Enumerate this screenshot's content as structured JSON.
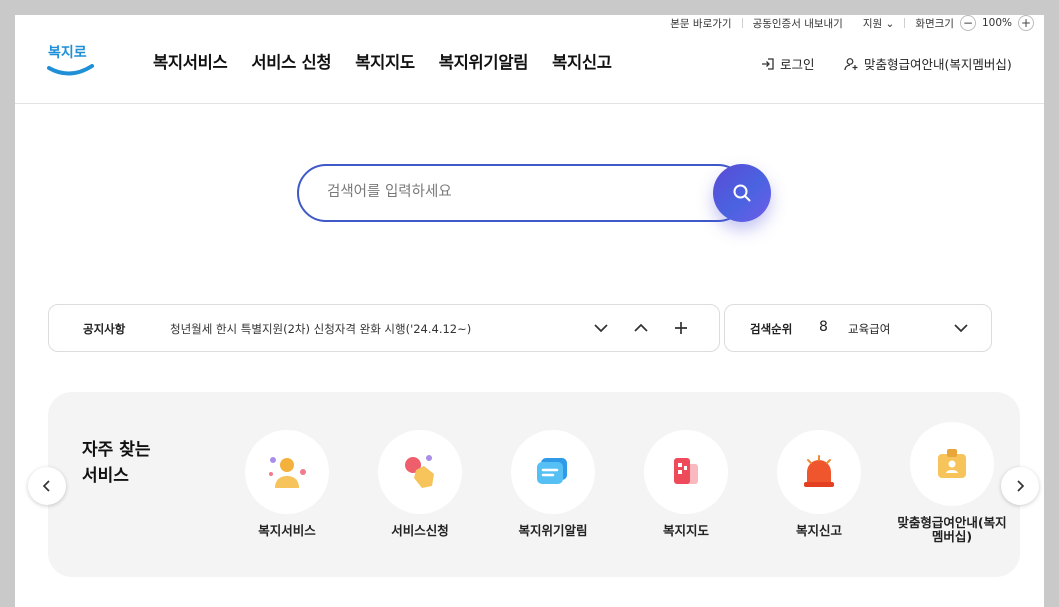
{
  "utility": {
    "skip_link": "본문 바로가기",
    "cert_export": "공동인증서 내보내기",
    "support": "지원",
    "screen_size": "화면크기",
    "zoom_minus": "−",
    "zoom_value": "100%",
    "zoom_plus": "+"
  },
  "logo": {
    "text": "복지로"
  },
  "nav": {
    "items": [
      "복지서비스",
      "서비스 신청",
      "복지지도",
      "복지위기알림",
      "복지신고"
    ]
  },
  "account": {
    "login": "로그인",
    "membership": "맞춤형급여안내(복지멤버십)"
  },
  "search": {
    "placeholder": "검색어를 입력하세요"
  },
  "notice": {
    "label": "공지사항",
    "text": "청년월세 한시 특별지원(2차) 신청자격 완화 시행('24.4.12~)"
  },
  "rank": {
    "label": "검색순위",
    "number": "8",
    "keyword": "교육급여"
  },
  "services": {
    "title_line1": "자주 찾는",
    "title_line2": "서비스",
    "items": [
      {
        "label": "복지서비스"
      },
      {
        "label": "서비스신청"
      },
      {
        "label": "복지위기알림"
      },
      {
        "label": "복지지도"
      },
      {
        "label": "복지신고"
      },
      {
        "label": "맞춤형급여안내(복지멤버십)"
      }
    ]
  },
  "colors": {
    "accent": "#3f59c8",
    "logo": "#1f8fd6"
  }
}
